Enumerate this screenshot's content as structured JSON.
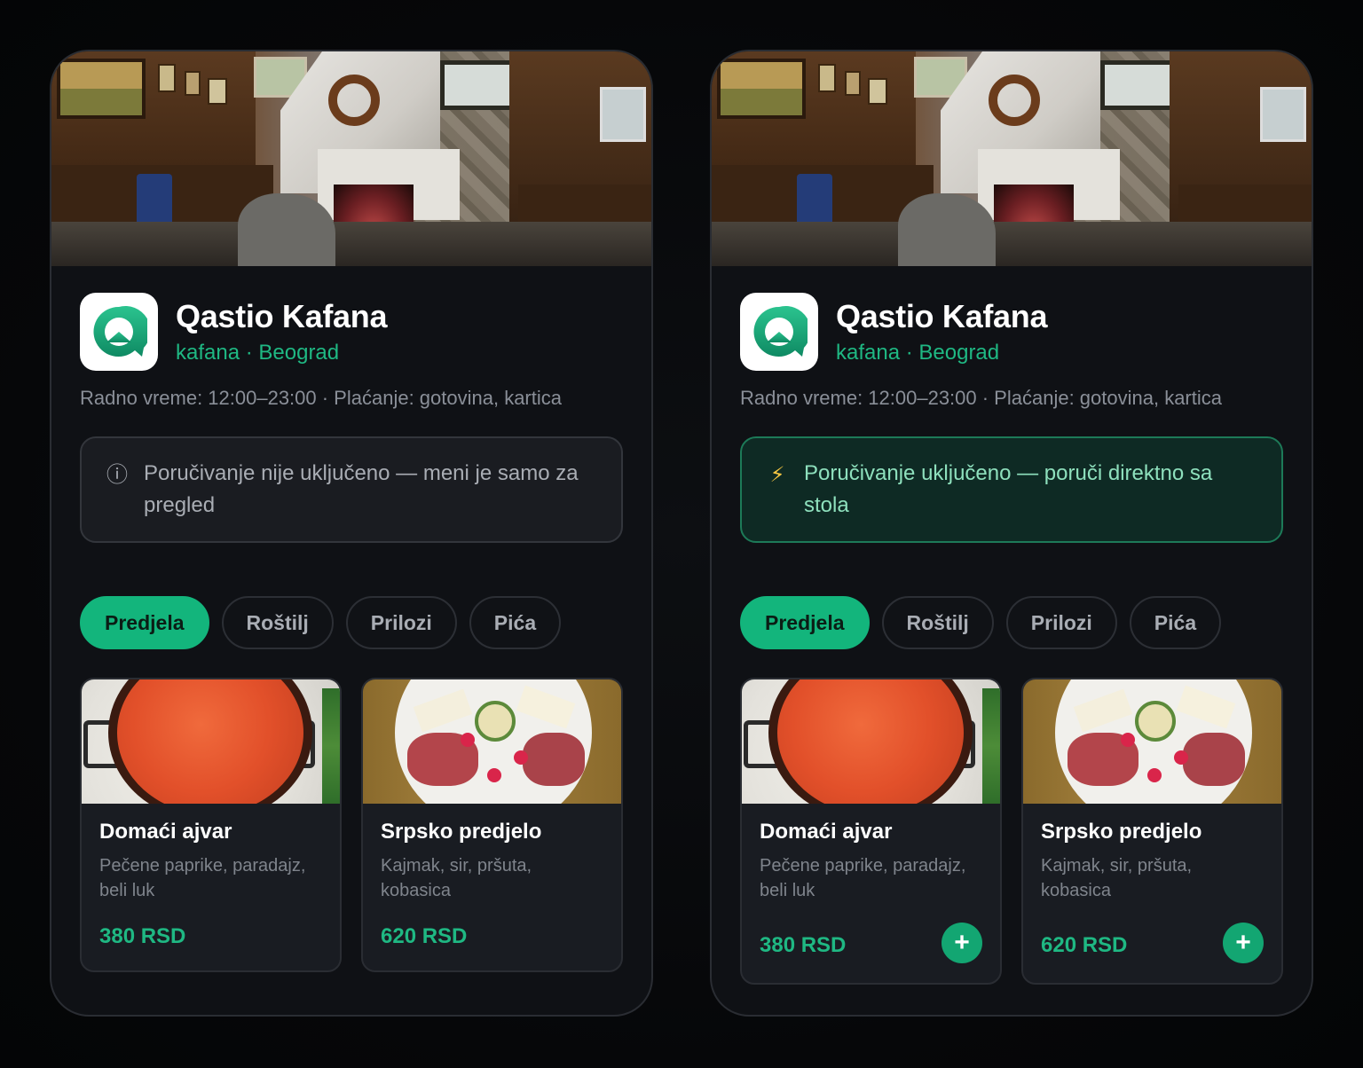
{
  "left": {
    "venue": {
      "name": "Qastio Kafana",
      "subtitle": "kafana · Beograd",
      "info": "Radno vreme: 12:00–23:00 · Plaćanje: gotovina, kartica"
    },
    "notice": {
      "icon": "info-icon",
      "glyph": "ⓘ",
      "text": "Poručivanje nije uključeno — meni je samo za pregled"
    },
    "tabs": [
      {
        "label": "Predjela",
        "active": true
      },
      {
        "label": "Roštilj",
        "active": false
      },
      {
        "label": "Prilozi",
        "active": false
      },
      {
        "label": "Pića",
        "active": false
      }
    ],
    "dishes": [
      {
        "name": "Domaći ajvar",
        "desc": "Pečene paprike, paradajz, beli luk",
        "price": "380 RSD"
      },
      {
        "name": "Srpsko predjelo",
        "desc": "Kajmak, sir, pršuta, kobasica",
        "price": "620 RSD"
      }
    ]
  },
  "right": {
    "venue": {
      "name": "Qastio Kafana",
      "subtitle": "kafana · Beograd",
      "info": "Radno vreme: 12:00–23:00 · Plaćanje: gotovina, kartica"
    },
    "notice": {
      "icon": "lightning-icon",
      "glyph": "⚡",
      "text": "Poručivanje uključeno — poruči direktno sa stola"
    },
    "tabs": [
      {
        "label": "Predjela",
        "active": true
      },
      {
        "label": "Roštilj",
        "active": false
      },
      {
        "label": "Prilozi",
        "active": false
      },
      {
        "label": "Pića",
        "active": false
      }
    ],
    "dishes": [
      {
        "name": "Domaći ajvar",
        "desc": "Pečene paprike, paradajz, beli luk",
        "price": "380 RSD",
        "add": "+"
      },
      {
        "name": "Srpsko predjelo",
        "desc": "Kajmak, sir, pršuta, kobasica",
        "price": "620 RSD",
        "add": "+"
      }
    ]
  },
  "colors": {
    "accent": "#13b57c",
    "accent_text": "#1fb883",
    "background": "#0f1115"
  }
}
